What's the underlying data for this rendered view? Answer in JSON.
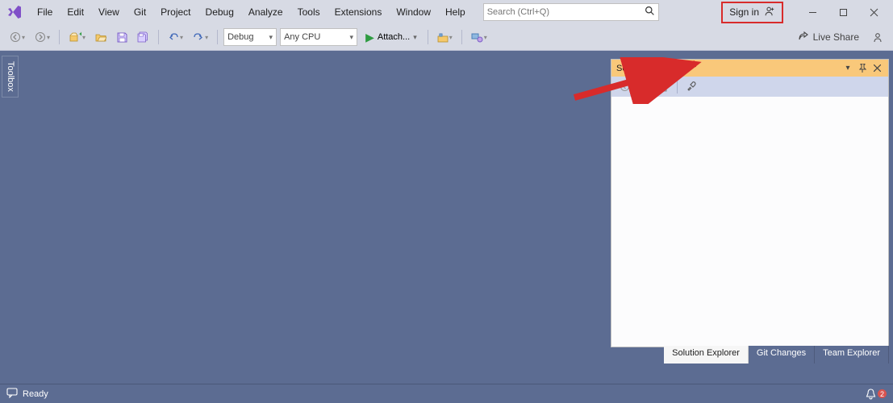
{
  "colors": {
    "highlight_red": "#d82b2b",
    "panel_orange": "#f9c87a",
    "workarea_bg": "#5c6c92"
  },
  "menubar": {
    "items": [
      "File",
      "Edit",
      "View",
      "Git",
      "Project",
      "Debug",
      "Analyze",
      "Tools",
      "Extensions",
      "Window",
      "Help"
    ]
  },
  "search": {
    "placeholder": "Search (Ctrl+Q)",
    "icon": "search-icon"
  },
  "signin": {
    "label": "Sign in",
    "icon": "person-add-icon"
  },
  "toolbar": {
    "config_combo": "Debug",
    "platform_combo": "Any CPU",
    "attach_label": "Attach..."
  },
  "liveshare": {
    "label": "Live Share",
    "icon": "share-icon"
  },
  "toolbox": {
    "label": "Toolbox"
  },
  "solution_explorer": {
    "title": "Solution Explorer",
    "tabs": [
      "Solution Explorer",
      "Git Changes",
      "Team Explorer"
    ],
    "active_tab": 0
  },
  "statusbar": {
    "ready": "Ready",
    "notification_count": "2"
  }
}
